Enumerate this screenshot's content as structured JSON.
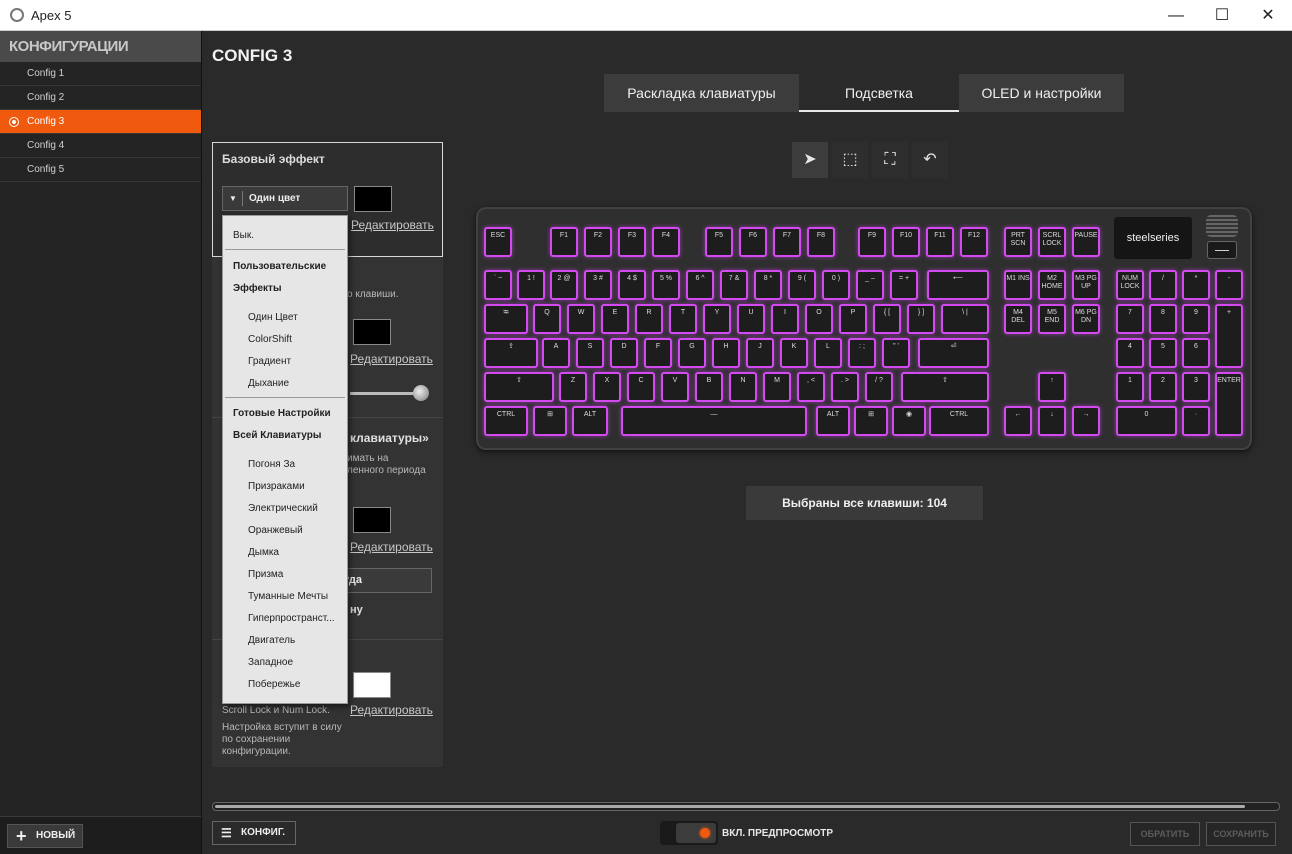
{
  "window": {
    "title": "Apex 5",
    "minimize": "—",
    "maximize": "☐",
    "close": "✕"
  },
  "sidebar": {
    "header": "КОНФИГУРАЦИИ",
    "items": [
      {
        "label": "Config 1"
      },
      {
        "label": "Config 2"
      },
      {
        "label": "Config 3"
      },
      {
        "label": "Config 4"
      },
      {
        "label": "Config 5"
      }
    ],
    "new_label": "НОВЫЙ"
  },
  "main": {
    "title": "CONFIG 3",
    "tabs": [
      {
        "label": "Раскладка клавиатуры"
      },
      {
        "label": "Подсветка"
      },
      {
        "label": "OLED и настройки"
      }
    ]
  },
  "panel": {
    "base_effect_title": "Базовый эффект",
    "effect_value": "Один цвет",
    "edit_label": "Редактировать",
    "snippet_keys": "о клавиши.",
    "snippet_keyboard_title": "клавиатуры»",
    "snippet_line1": "имать на",
    "snippet_line2": "ленного периода",
    "snippet_button": "уда",
    "snippet_bold": "ну",
    "snippet_lock": "Scroll Lock и Num Lock.",
    "note": "Настройка вступит в силу по сохранении конфигурации."
  },
  "dropdown": {
    "items": [
      {
        "label": "Вык.",
        "group": false
      },
      {
        "label": "Пользовательские",
        "group": true
      },
      {
        "label": "Эффекты",
        "group": true
      },
      {
        "label": "Один Цвет",
        "group": false
      },
      {
        "label": "ColorShift",
        "group": false
      },
      {
        "label": "Градиент",
        "group": false
      },
      {
        "label": "Дыхание",
        "group": false
      },
      {
        "label": "Готовые Настройки",
        "group": true
      },
      {
        "label": "Всей Клавиатуры",
        "group": true
      },
      {
        "label": "Погоня За",
        "group": false
      },
      {
        "label": "Призраками",
        "group": false
      },
      {
        "label": "Электрический",
        "group": false
      },
      {
        "label": "Оранжевый",
        "group": false
      },
      {
        "label": "Дымка",
        "group": false
      },
      {
        "label": "Призма",
        "group": false
      },
      {
        "label": "Туманные Мечты",
        "group": false
      },
      {
        "label": "Гиперпространст...",
        "group": false
      },
      {
        "label": "Двигатель",
        "group": false
      },
      {
        "label": "Западное",
        "group": false
      },
      {
        "label": "Побережье",
        "group": false
      }
    ]
  },
  "tools": [
    {
      "name": "select-tool",
      "glyph": "➤"
    },
    {
      "name": "box-select-tool",
      "glyph": "⬚"
    },
    {
      "name": "select-all-tool",
      "glyph": "⛶"
    },
    {
      "name": "undo-tool",
      "glyph": "↶"
    }
  ],
  "keyboard": {
    "logo": "steelseries",
    "keys": {
      "esc": "ESC",
      "f1": "F1",
      "f2": "F2",
      "f3": "F3",
      "f4": "F4",
      "f5": "F5",
      "f6": "F6",
      "f7": "F7",
      "f8": "F8",
      "f9": "F9",
      "f10": "F10",
      "f11": "F11",
      "f12": "F12",
      "prtscn": "PRT SCN",
      "scrlock": "SCRL LOCK",
      "pause": "PAUSE",
      "tilde": "` ~",
      "n1": "1 !",
      "n2": "2 @",
      "n3": "3 #",
      "n4": "4 $",
      "n5": "5 %",
      "n6": "6 ^",
      "n7": "7 &",
      "n8": "8 *",
      "n9": "9 (",
      "n0": "0 )",
      "minus": "_ –",
      "equals": "= +",
      "backspace": "⟵",
      "m1": "M1 INS",
      "m2": "M2 HOME",
      "m3": "M3 PG UP",
      "numlock": "NUM LOCK",
      "numdiv": "/",
      "nummul": "*",
      "numsub": "-",
      "tab": "⭾",
      "q": "Q",
      "w": "W",
      "e": "E",
      "r": "R",
      "t": "T",
      "y": "Y",
      "u": "U",
      "i": "I",
      "o": "O",
      "p": "P",
      "lbracket": "{ [",
      "rbracket": "} ]",
      "backslash": "\\ |",
      "m4": "M4 DEL",
      "m5": "M5 END",
      "m6": "M6 PG DN",
      "num7": "7",
      "num8": "8",
      "num9": "9",
      "numadd": "+",
      "caps": "⇪",
      "a": "A",
      "s": "S",
      "d": "D",
      "f": "F",
      "g": "G",
      "h": "H",
      "j": "J",
      "k": "K",
      "l": "L",
      "semicolon": ": ;",
      "quote": "\" '",
      "enter": "⏎",
      "num4": "4",
      "num5": "5",
      "num6": "6",
      "lshift": "⇧",
      "z": "Z",
      "x": "X",
      "c": "C",
      "v": "V",
      "b": "B",
      "n": "N",
      "m": "M",
      "comma": ", <",
      "period": ". >",
      "slash": "/ ?",
      "rshift": "⇧",
      "up": "↑",
      "num1": "1",
      "num2": "2",
      "num3": "3",
      "numenter": "ENTER",
      "lctrl": "CTRL",
      "lwin": "⊞",
      "lalt": "ALT",
      "space": "—",
      "ralt": "ALT",
      "rwin": "⊞",
      "fn": "◉",
      "rctrl": "CTRL",
      "left": "←",
      "down": "↓",
      "right": "→",
      "num0": "0",
      "numdot": "·"
    }
  },
  "status": {
    "selected_text": "Выбраны все клавиши: 104"
  },
  "bottom": {
    "config_label": "КОНФИГ.",
    "preview_label": "ВКЛ. ПРЕДПРОСМОТР",
    "revert_label": "ОБРАТИТЬ",
    "save_label": "СОХРАНИТЬ"
  },
  "colors": {
    "accent": "#f05a0f",
    "key_glow": "#d34bf0"
  }
}
